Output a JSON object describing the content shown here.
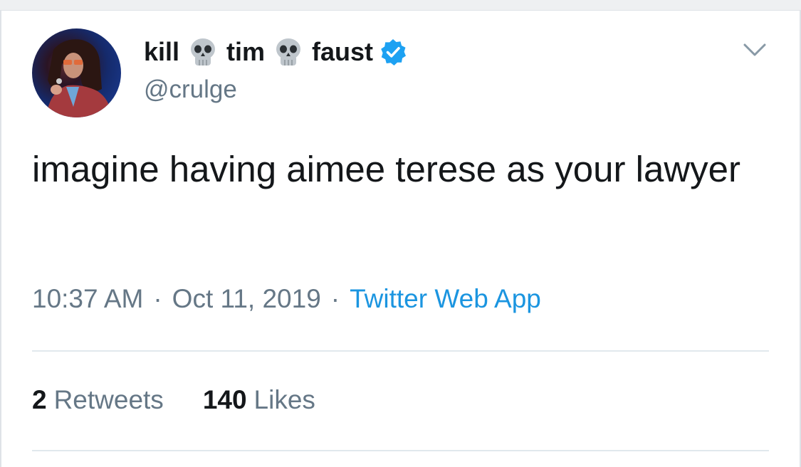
{
  "tweet": {
    "author": {
      "name_parts": [
        "kill",
        "tim",
        "faust"
      ],
      "name_icons": [
        "skull-icon",
        "skull-icon"
      ],
      "handle": "@crulge",
      "verified_icon": "verified-badge-icon"
    },
    "text": "imagine having aimee terese as your lawyer",
    "time": "10:37 AM",
    "date": "Oct 11, 2019",
    "separator": "·",
    "source": "Twitter Web App",
    "stats": {
      "retweets_count": "2",
      "retweets_label": "Retweets",
      "likes_count": "140",
      "likes_label": "Likes"
    },
    "menu_icon": "chevron-down-icon"
  },
  "colors": {
    "text_primary": "#14171a",
    "text_secondary": "#657786",
    "link": "#1b95e0",
    "verified": "#1da1f2",
    "divider": "#e1e8ed"
  }
}
